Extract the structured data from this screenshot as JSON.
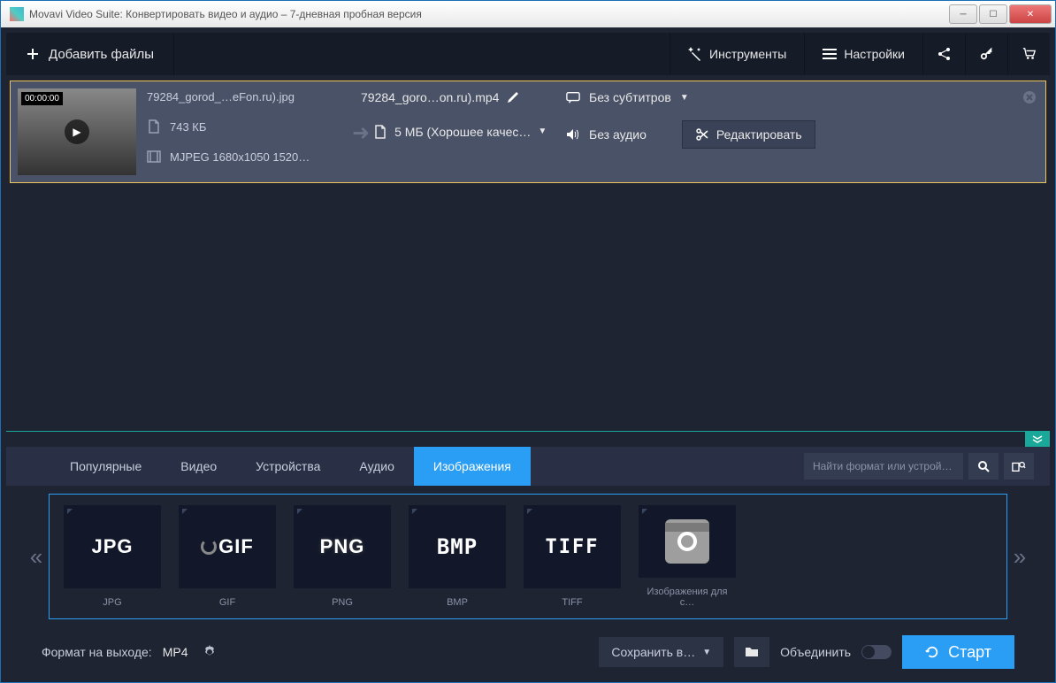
{
  "window": {
    "title": "Movavi Video Suite: Конвертировать видео и аудио – 7-дневная пробная версия"
  },
  "topbar": {
    "add": "Добавить файлы",
    "tools": "Инструменты",
    "settings": "Настройки"
  },
  "file": {
    "timestamp": "00:00:00",
    "name": "79284_gorod_…eFon.ru).jpg",
    "size": "743 КБ",
    "codec": "MJPEG 1680x1050 1520…",
    "out_name": "79284_goro…on.ru).mp4",
    "out_size": "5 МБ (Хорошее качес…",
    "subtitles": "Без субтитров",
    "audio": "Без аудио",
    "edit": "Редактировать"
  },
  "tabs": {
    "popular": "Популярные",
    "video": "Видео",
    "devices": "Устройства",
    "audio": "Аудио",
    "images": "Изображения"
  },
  "search": {
    "placeholder": "Найти формат или устрой…"
  },
  "formats": {
    "jpg": {
      "label": "JPG",
      "caption": "JPG"
    },
    "gif": {
      "label": "GIF",
      "caption": "GIF"
    },
    "png": {
      "label": "PNG",
      "caption": "PNG"
    },
    "bmp": {
      "label": "BMP",
      "caption": "BMP"
    },
    "tiff": {
      "label": "TIFF",
      "caption": "TIFF"
    },
    "instagram": {
      "caption": "Изображения для с…"
    }
  },
  "bottom": {
    "format_label": "Формат на выходе:",
    "format_value": "MP4",
    "save": "Сохранить в…",
    "merge": "Объединить",
    "start": "Старт"
  }
}
